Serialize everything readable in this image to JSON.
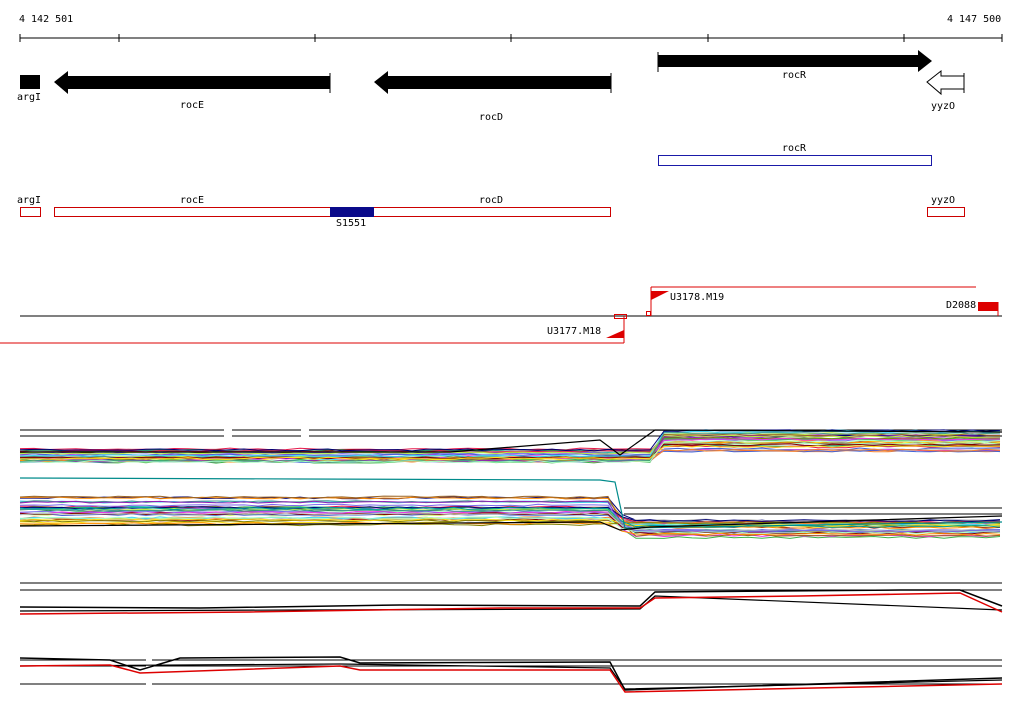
{
  "ruler": {
    "start_label": "4 142 501",
    "end_label": "4 147 500"
  },
  "genes": {
    "argI": "argI",
    "rocE": "rocE",
    "rocD": "rocD",
    "rocR": "rocR",
    "yyzO": "yyzO"
  },
  "transcripts": {
    "rocR": "rocR"
  },
  "annotation_track": {
    "argI": "argI",
    "rocE": "rocE",
    "rocD": "rocD",
    "yyzO": "yyzO",
    "s_feature": "S1551"
  },
  "transcription_units": {
    "upstream_forward": "U3178.M19",
    "downstream_reverse": "U3177.M18",
    "right_marker": "D2088"
  },
  "colors": {
    "gene_fill": "#000000",
    "annotation_box": "#cc0000",
    "transcript_box": "#1a1aa8",
    "s_block": "#0a0a8a",
    "tu_line": "#dd0000",
    "profile_black": "#000000",
    "profile_red": "#dd0000"
  }
}
